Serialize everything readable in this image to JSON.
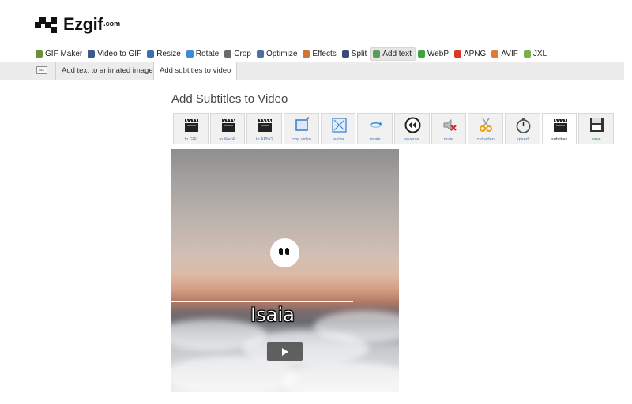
{
  "logo": {
    "name": "Ezgif",
    "tld": ".com"
  },
  "nav": {
    "items": [
      {
        "label": "GIF Maker",
        "icon": "gif-maker-icon",
        "color": "#6a8f3a",
        "active": false
      },
      {
        "label": "Video to GIF",
        "icon": "film-icon",
        "color": "#3b5a8a",
        "active": false
      },
      {
        "label": "Resize",
        "icon": "resize-icon",
        "color": "#3c6fb0",
        "active": false
      },
      {
        "label": "Rotate",
        "icon": "rotate-icon",
        "color": "#3c8ccf",
        "active": false
      },
      {
        "label": "Crop",
        "icon": "crop-icon",
        "color": "#6b6b6b",
        "active": false
      },
      {
        "label": "Optimize",
        "icon": "optimize-icon",
        "color": "#4a6fa5",
        "active": false
      },
      {
        "label": "Effects",
        "icon": "effects-icon",
        "color": "#c8783a",
        "active": false
      },
      {
        "label": "Split",
        "icon": "split-icon",
        "color": "#3a4a7a",
        "active": false
      },
      {
        "label": "Add text",
        "icon": "add-text-icon",
        "color": "#5a9a5a",
        "active": true
      },
      {
        "label": "WebP",
        "icon": "webp-icon",
        "color": "#3aa63a",
        "active": false
      },
      {
        "label": "APNG",
        "icon": "apng-icon",
        "color": "#d83a2a",
        "active": false
      },
      {
        "label": "AVIF",
        "icon": "avif-icon",
        "color": "#e07a3a",
        "active": false
      },
      {
        "label": "JXL",
        "icon": "jxl-icon",
        "color": "#7ab04a",
        "active": false
      }
    ]
  },
  "subnav": {
    "tabs": [
      {
        "label": "Add text to animated images",
        "active": false
      },
      {
        "label": "Add subtitles to video",
        "active": true
      }
    ]
  },
  "page": {
    "title": "Add Subtitles to Video"
  },
  "toolbar": {
    "tools": [
      {
        "label": "to GIF",
        "icon": "clapperboard-icon"
      },
      {
        "label": "to WebP",
        "icon": "clapperboard-icon"
      },
      {
        "label": "to APNG",
        "icon": "clapperboard-icon"
      },
      {
        "label": "crop video",
        "icon": "crop-icon"
      },
      {
        "label": "resize",
        "icon": "resize-icon"
      },
      {
        "label": "rotate",
        "icon": "rotate-icon"
      },
      {
        "label": "reverse",
        "icon": "rewind-icon"
      },
      {
        "label": "mute",
        "icon": "mute-speaker-icon"
      },
      {
        "label": "cut video",
        "icon": "scissors-icon"
      },
      {
        "label": "speed",
        "icon": "stopwatch-icon"
      },
      {
        "label": "subtitles",
        "icon": "clapperboard-icon"
      },
      {
        "label": "save",
        "icon": "floppy-disk-icon"
      }
    ]
  },
  "video": {
    "subtitle": "Isaia"
  }
}
